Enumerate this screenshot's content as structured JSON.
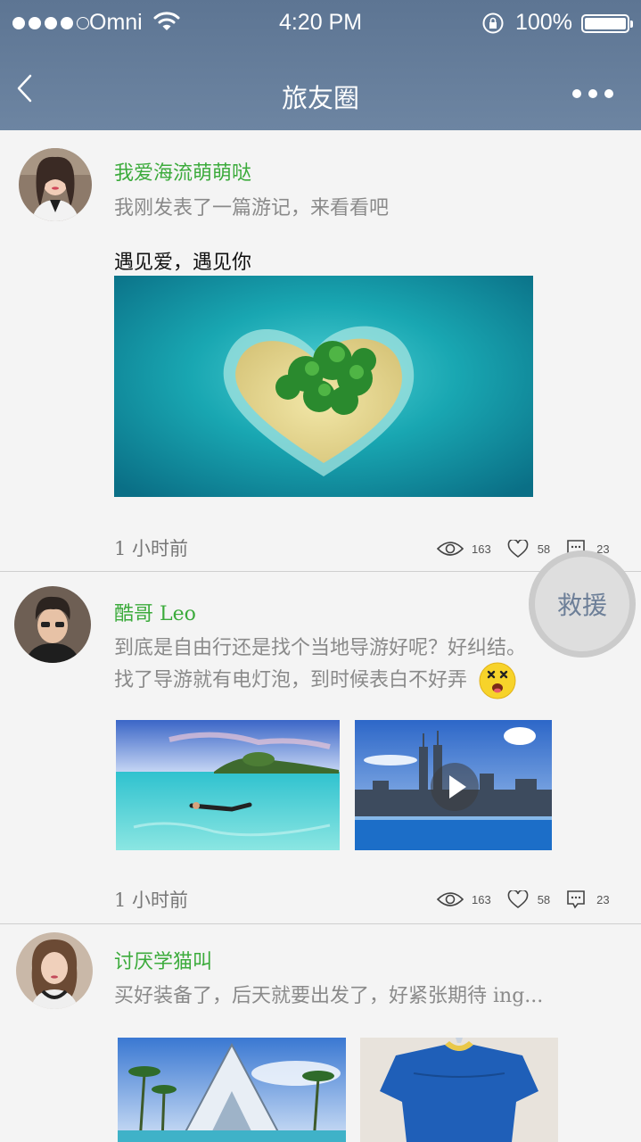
{
  "status_bar": {
    "carrier": "Omni",
    "time": "4:20 PM",
    "battery": "100%"
  },
  "nav": {
    "title": "旅友圈"
  },
  "rescue_label": "救援",
  "posts": [
    {
      "username": "我爱海流萌萌哒",
      "text": "我刚发表了一篇游记，来看看吧",
      "headline": "遇见爱，遇见你",
      "time": "1 小时前",
      "views": "163",
      "likes": "58",
      "comments": "23"
    },
    {
      "username": "酷哥 Leo",
      "text_line1": "到底是自由行还是找个当地导游好呢？好纠结。",
      "text_line2": "找了导游就有电灯泡，到时候表白不好弄",
      "time": "1 小时前",
      "views": "163",
      "likes": "58",
      "comments": "23"
    },
    {
      "username": "讨厌学猫叫",
      "text": "买好装备了，后天就要出发了，好紧张期待 ing..."
    }
  ]
}
